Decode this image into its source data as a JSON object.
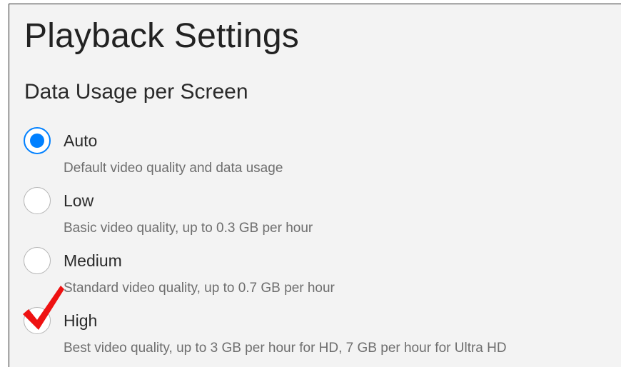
{
  "page": {
    "title": "Playback Settings",
    "section_title": "Data Usage per Screen"
  },
  "options": [
    {
      "label": "Auto",
      "description": "Default video quality and data usage",
      "selected": true
    },
    {
      "label": "Low",
      "description": "Basic video quality, up to 0.3 GB per hour",
      "selected": false
    },
    {
      "label": "Medium",
      "description": "Standard video quality, up to 0.7 GB per hour",
      "selected": false
    },
    {
      "label": "High",
      "description": "Best video quality, up to 3 GB per hour for HD, 7 GB per hour for Ultra HD",
      "selected": false
    }
  ],
  "annotation": {
    "icon": "red-checkmark-icon",
    "color": "#ee1111"
  },
  "colors": {
    "accent": "#0080ff",
    "background": "#f3f3f3"
  }
}
